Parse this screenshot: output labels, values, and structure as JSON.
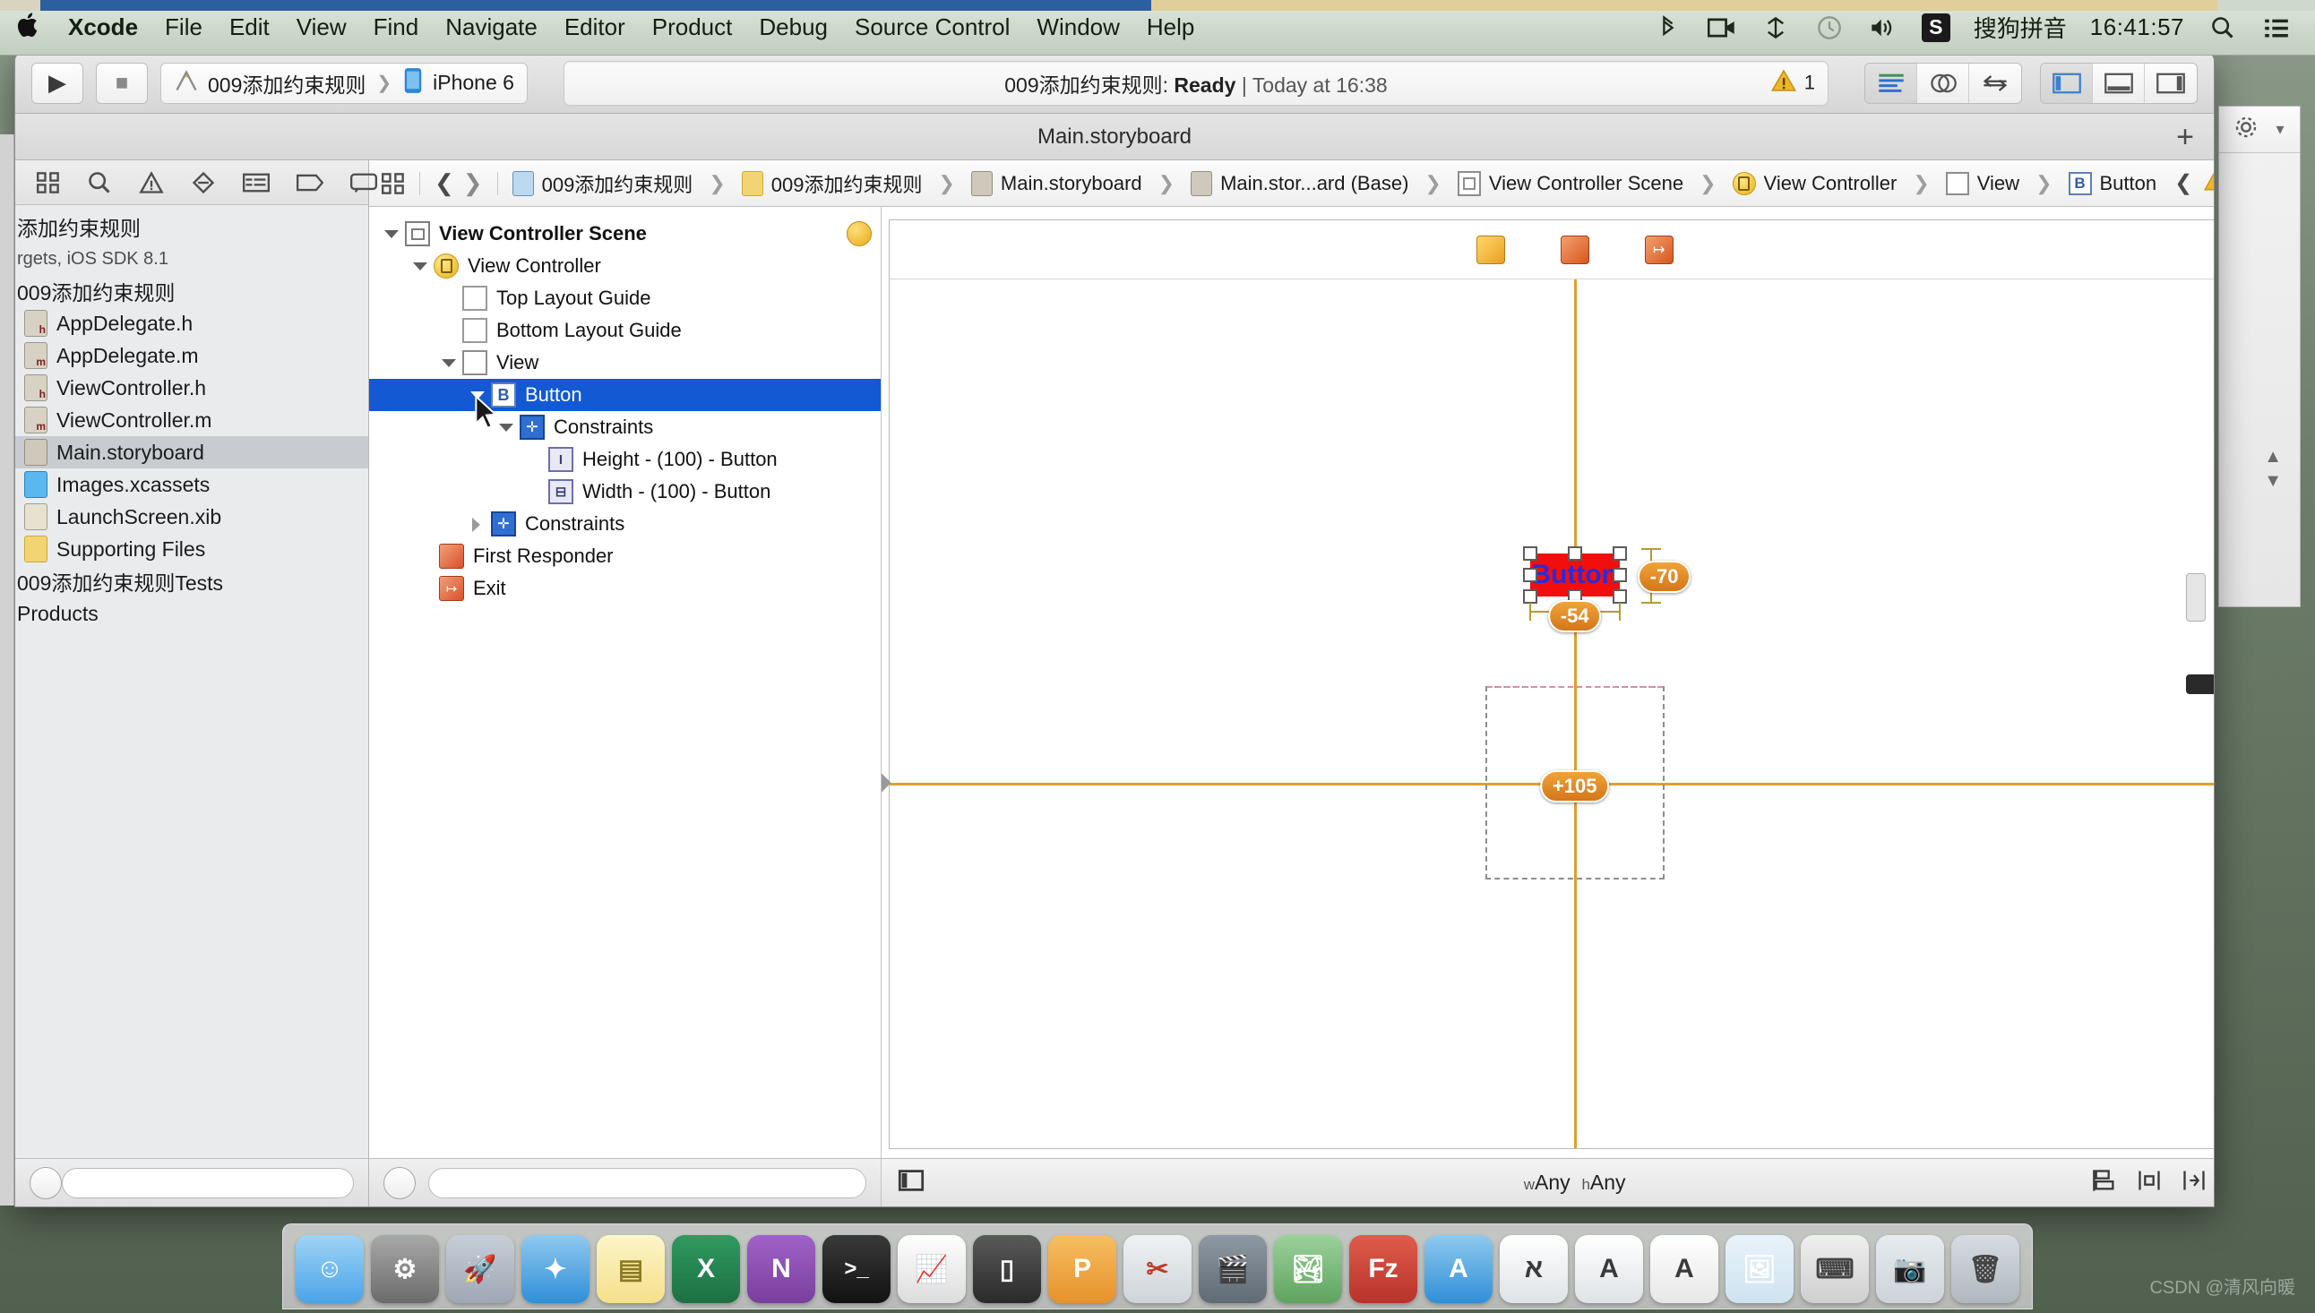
{
  "menubar": {
    "apple_glyph": "&#63743;",
    "items": [
      "Xcode",
      "File",
      "Edit",
      "View",
      "Find",
      "Navigate",
      "Editor",
      "Product",
      "Debug",
      "Source Control",
      "Window",
      "Help"
    ],
    "input_method": "搜狗拼音",
    "clock": "16:41:57",
    "icons": [
      "bluetooth-icon",
      "screen-record-icon",
      "airdrop-icon",
      "timemachine-icon",
      "volume-icon",
      "sogou-icon",
      "spotlight-icon",
      "notification-center-icon"
    ]
  },
  "toolbar": {
    "run_label": "▶",
    "stop_label": "■",
    "scheme_name": "009添加约束规则",
    "scheme_sep": "❯",
    "destination": "iPhone 6",
    "status_project": "009添加约束规则:",
    "status_state": "Ready",
    "status_divider": "|",
    "status_time": "Today at 16:38",
    "warning_count": "1",
    "editor_modes": [
      "standard-editor",
      "assistant-editor",
      "version-editor"
    ],
    "view_toggles": [
      "navigator-toggle",
      "debug-area-toggle",
      "utilities-toggle"
    ]
  },
  "window": {
    "document_title": "Main.storyboard",
    "add_tab": "+"
  },
  "navigator": {
    "filter_icons": [
      "project-navigator-icon",
      "search-navigator-icon",
      "issue-navigator-icon",
      "test-navigator-icon",
      "debug-navigator-icon",
      "breakpoint-navigator-icon",
      "report-navigator-icon"
    ],
    "items": [
      {
        "label": "添加约束规则",
        "kind": "project",
        "indent": 0,
        "selected": false
      },
      {
        "label": "rgets, iOS SDK 8.1",
        "kind": "subtitle",
        "indent": 0,
        "selected": false
      },
      {
        "label": "009添加约束规则",
        "kind": "group",
        "indent": 0,
        "selected": false
      },
      {
        "label": "AppDelegate.h",
        "kind": "header",
        "indent": 1,
        "selected": false
      },
      {
        "label": "AppDelegate.m",
        "kind": "source",
        "indent": 1,
        "selected": false
      },
      {
        "label": "ViewController.h",
        "kind": "header",
        "indent": 1,
        "selected": false
      },
      {
        "label": "ViewController.m",
        "kind": "source",
        "indent": 1,
        "selected": false
      },
      {
        "label": "Main.storyboard",
        "kind": "storyboard",
        "indent": 1,
        "selected": true
      },
      {
        "label": "Images.xcassets",
        "kind": "xcassets",
        "indent": 1,
        "selected": false
      },
      {
        "label": "LaunchScreen.xib",
        "kind": "xib",
        "indent": 1,
        "selected": false
      },
      {
        "label": "Supporting Files",
        "kind": "folder",
        "indent": 1,
        "selected": false
      },
      {
        "label": "009添加约束规则Tests",
        "kind": "group",
        "indent": 0,
        "selected": false
      },
      {
        "label": "Products",
        "kind": "group",
        "indent": 0,
        "selected": false
      }
    ]
  },
  "jumpbar": {
    "back": "❮",
    "forward": "❯",
    "crumbs": [
      {
        "label": "009添加约束规则",
        "icon": "project-icon"
      },
      {
        "label": "009添加约束规则",
        "icon": "folder-icon"
      },
      {
        "label": "Main.storyboard",
        "icon": "storyboard-icon"
      },
      {
        "label": "Main.stor...ard (Base)",
        "icon": "storyboard-icon"
      },
      {
        "label": "View Controller Scene",
        "icon": "scene-icon"
      },
      {
        "label": "View Controller",
        "icon": "view-controller-icon"
      },
      {
        "label": "View",
        "icon": "view-icon"
      },
      {
        "label": "Button",
        "icon": "button-icon"
      }
    ],
    "separator": "❯",
    "right_icons": [
      "previous-issue-icon",
      "warning-icon",
      "next-issue-icon"
    ]
  },
  "outline": {
    "rows": [
      {
        "label": "View Controller Scene",
        "indent": 0,
        "disclosure": "down",
        "icon": "scene",
        "selected": false,
        "trailing": "scene-exit-badge"
      },
      {
        "label": "View Controller",
        "indent": 1,
        "disclosure": "down",
        "icon": "viewcontroller",
        "selected": false
      },
      {
        "label": "Top Layout Guide",
        "indent": 2,
        "disclosure": "none",
        "icon": "guide",
        "selected": false
      },
      {
        "label": "Bottom Layout Guide",
        "indent": 2,
        "disclosure": "none",
        "icon": "guide",
        "selected": false
      },
      {
        "label": "View",
        "indent": 2,
        "disclosure": "down",
        "icon": "view",
        "selected": false
      },
      {
        "label": "Button",
        "indent": 3,
        "disclosure": "down",
        "icon": "button",
        "selected": true
      },
      {
        "label": "Constraints",
        "indent": 4,
        "disclosure": "down",
        "icon": "constraint",
        "selected": false
      },
      {
        "label": "Height - (100) - Button",
        "indent": 5,
        "disclosure": "none",
        "icon": "ctype-height",
        "selected": false
      },
      {
        "label": "Width - (100) - Button",
        "indent": 5,
        "disclosure": "none",
        "icon": "ctype-width",
        "selected": false
      },
      {
        "label": "Constraints",
        "indent": 3,
        "disclosure": "right",
        "icon": "constraint",
        "selected": false
      },
      {
        "label": "First Responder",
        "indent": 2,
        "disclosure": "none",
        "icon": "responder",
        "selected": false
      },
      {
        "label": "Exit",
        "indent": 2,
        "disclosure": "none",
        "icon": "exit",
        "selected": false
      }
    ],
    "bottom_icon": "filter-circle-icon"
  },
  "canvas": {
    "top_icons": [
      "view-controller-badge",
      "first-responder-badge",
      "exit-badge"
    ],
    "status_battery": "battery-icon",
    "button_title": "Button",
    "button_color": "#f40d0d",
    "button_text_color": "#2b2bd8",
    "badges": [
      {
        "value": "-70",
        "name": "vertical-spacing-constraint-badge"
      },
      {
        "value": "-54",
        "name": "horizontal-spacing-constraint-badge"
      },
      {
        "value": "+105",
        "name": "center-offset-constraint-badge"
      }
    ],
    "size_class_w": "w",
    "size_class_w_val": "Any",
    "size_class_h": "h",
    "size_class_h_val": "Any",
    "bottom_icons": [
      "align-icon",
      "pin-icon",
      "resolve-issues-icon",
      "resizing-icon",
      "zoom-icon"
    ],
    "doc_outline_toggle": "document-outline-toggle"
  },
  "dock": {
    "items": [
      {
        "name": "finder",
        "color": "#4aa3e8",
        "glyph": "☺"
      },
      {
        "name": "system-preferences",
        "color": "#6b6b6b",
        "glyph": "⚙"
      },
      {
        "name": "launchpad",
        "color": "#9ea7b3",
        "glyph": "🚀"
      },
      {
        "name": "safari",
        "color": "#2f8fd8",
        "glyph": "✦"
      },
      {
        "name": "notes",
        "color": "#f5e08a",
        "glyph": "▤"
      },
      {
        "name": "excel",
        "color": "#1d7044",
        "glyph": "X"
      },
      {
        "name": "onenote",
        "color": "#7a3f9d",
        "glyph": "N"
      },
      {
        "name": "terminal",
        "color": "#1d1d1d",
        "glyph": "&gt;_"
      },
      {
        "name": "charts-app",
        "color": "#e8e8e8",
        "glyph": "📈"
      },
      {
        "name": "iphone-simulator",
        "color": "#3a3a3a",
        "glyph": "▯"
      },
      {
        "name": "pages",
        "color": "#f0a030",
        "glyph": "P"
      },
      {
        "name": "snipping-tool",
        "color": "#cfd4d8",
        "glyph": "✂"
      },
      {
        "name": "imovie",
        "color": "#5f6a74",
        "glyph": "🎬"
      },
      {
        "name": "photos",
        "color": "#6fb36f",
        "glyph": "🏞"
      },
      {
        "name": "filezilla",
        "color": "#c0392b",
        "glyph": "Fz"
      },
      {
        "name": "app-store",
        "color": "#4aa3e8",
        "glyph": "A"
      },
      {
        "name": "analytics",
        "color": "#dfe3e6",
        "glyph": "ﬡ"
      },
      {
        "name": "font-book",
        "color": "#dfe3e6",
        "glyph": "A"
      },
      {
        "name": "textedit",
        "color": "#e7e7e7",
        "glyph": "A"
      },
      {
        "name": "preview",
        "color": "#cfe3f0",
        "glyph": "🖼"
      },
      {
        "name": "keyboard-viewer",
        "color": "#d8d8d8",
        "glyph": "⌨"
      },
      {
        "name": "screenshot",
        "color": "#cdd3d8",
        "glyph": "📷"
      },
      {
        "name": "trash",
        "color": "#b9c0c6",
        "glyph": "🗑"
      }
    ]
  },
  "watermark": "CSDN @清风向暖"
}
